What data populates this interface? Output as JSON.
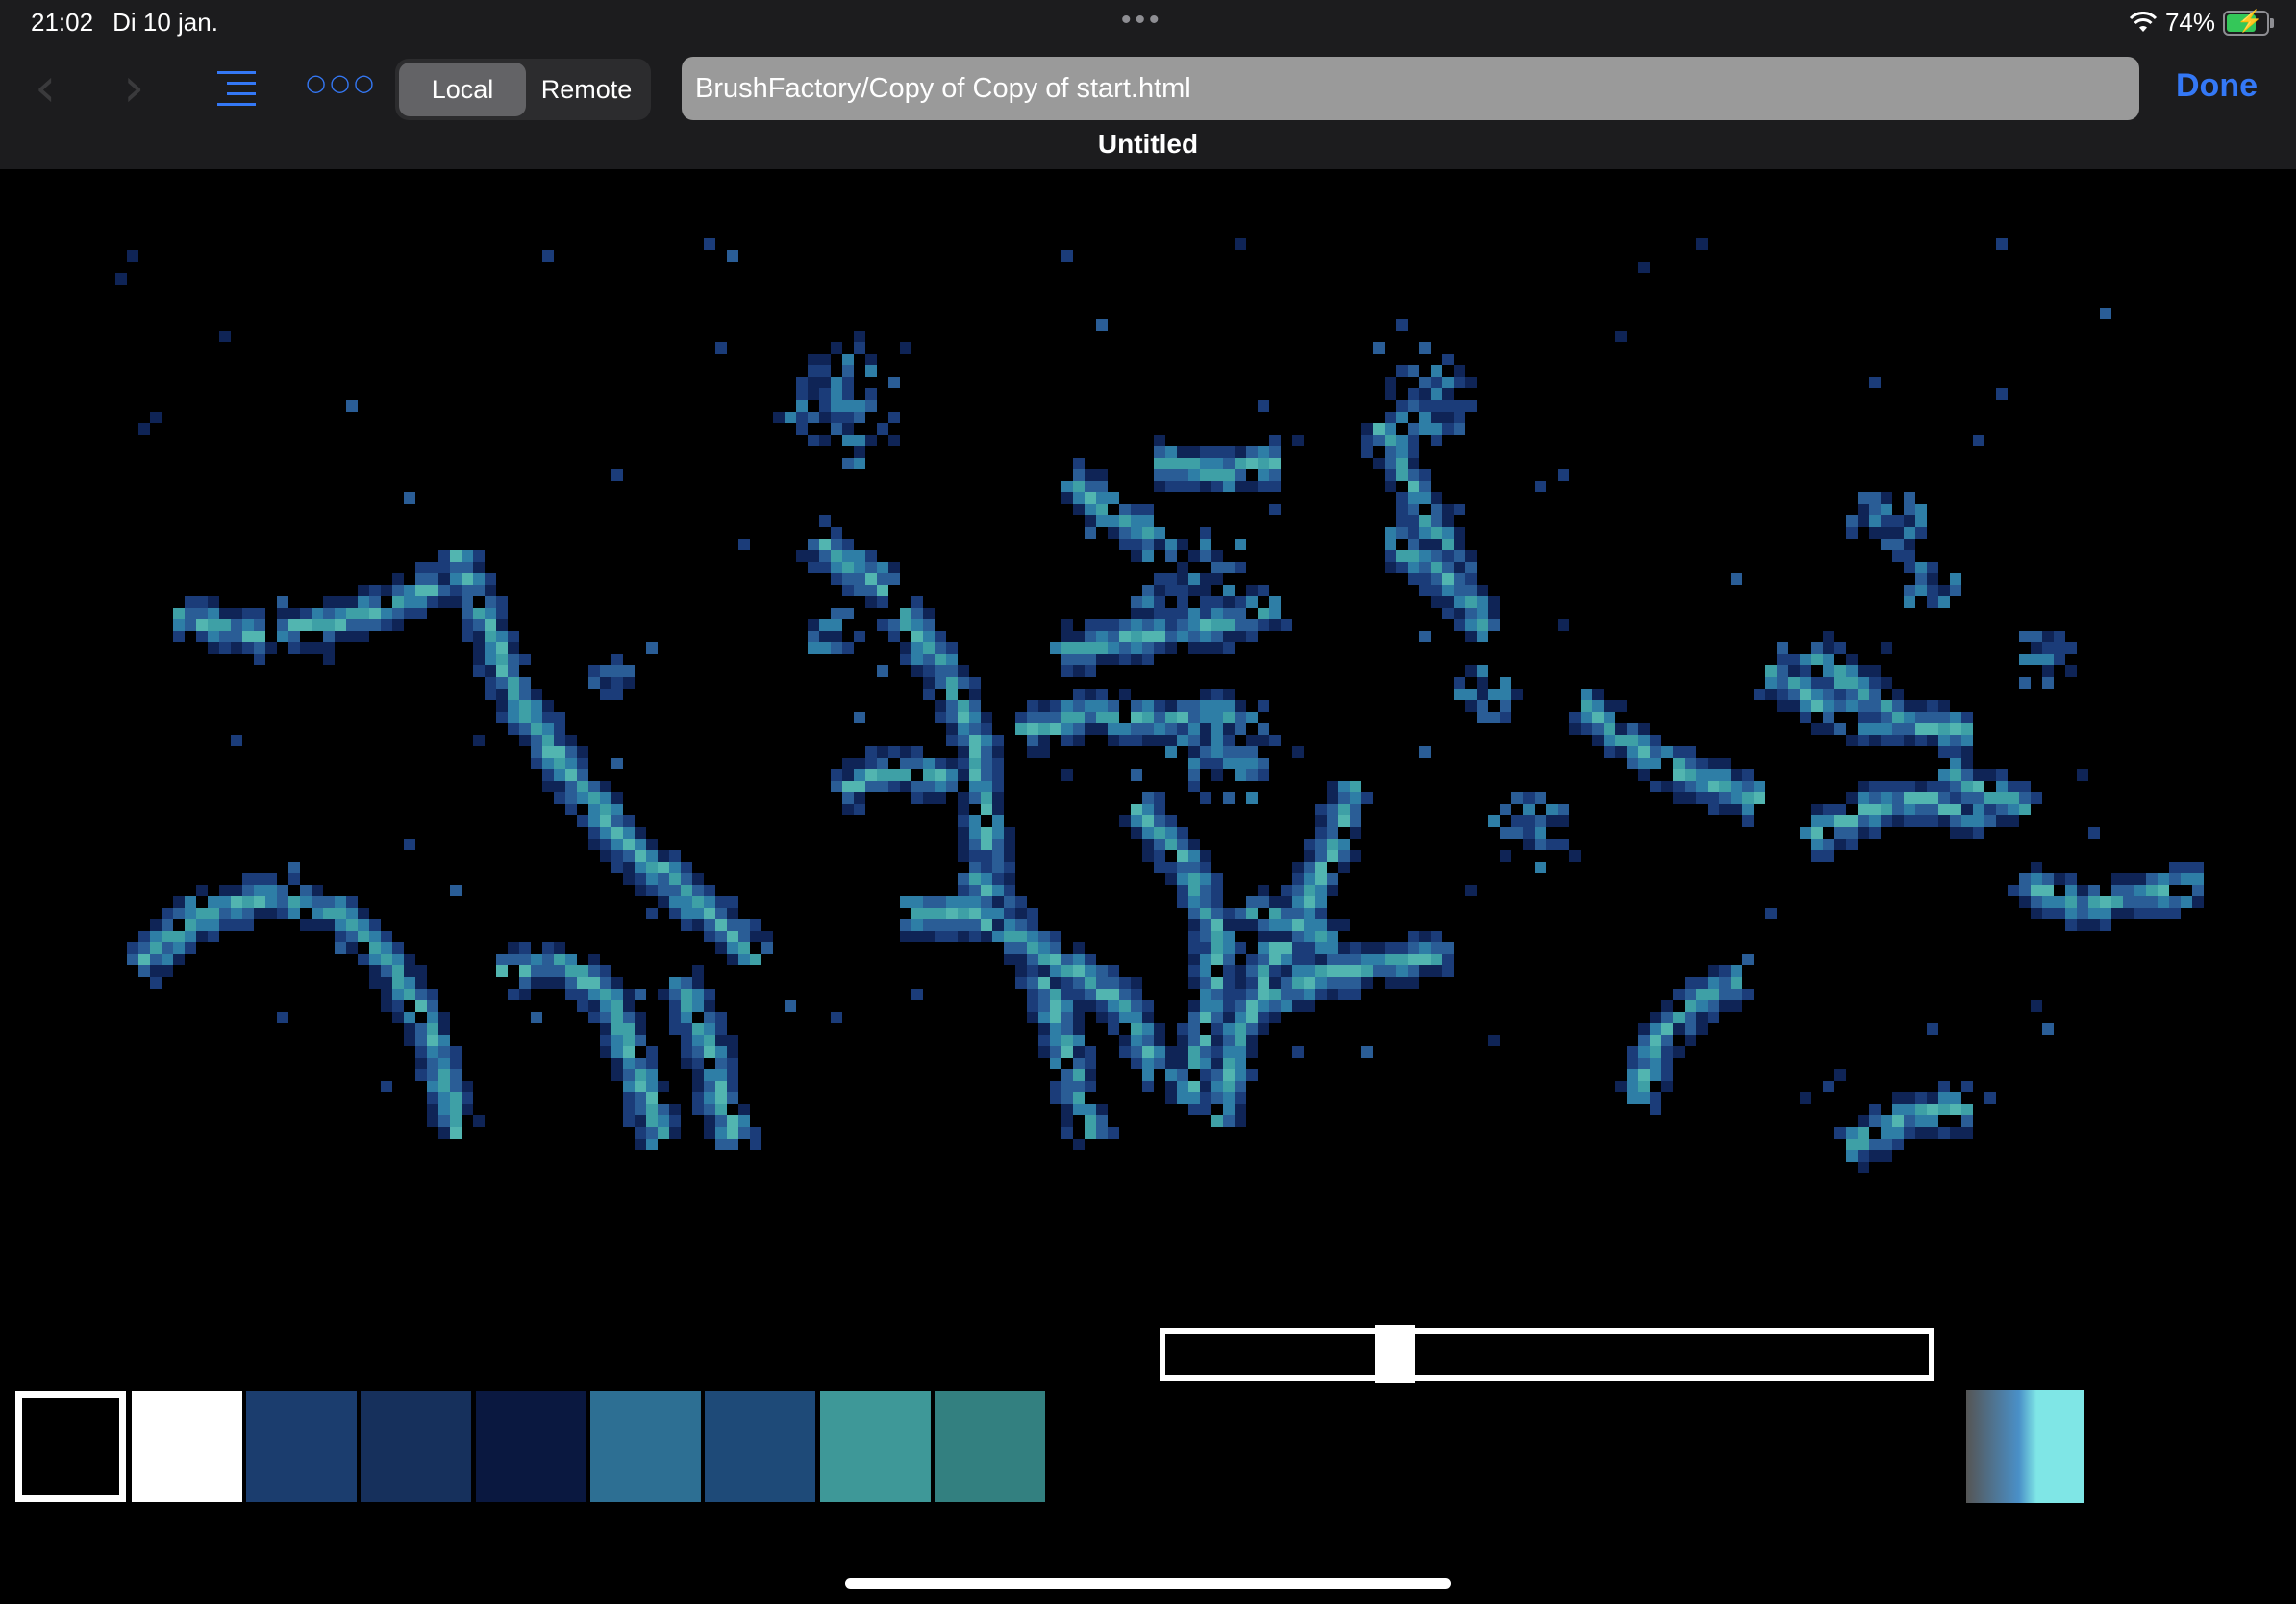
{
  "status_bar": {
    "time": "21:02",
    "date": "Di 10 jan.",
    "multitask_dots": "•••",
    "battery_percent": "74%",
    "battery_level": 0.74,
    "battery_charging": true
  },
  "toolbar": {
    "back_icon": "chevron-left-icon",
    "forward_icon": "chevron-right-icon",
    "toc_icon": "list-indent-icon",
    "more_icon": "ellipsis-icon",
    "segments": [
      {
        "label": "Local",
        "active": true
      },
      {
        "label": "Remote",
        "active": false
      }
    ],
    "path": "BrushFactory/Copy of Copy of start.html",
    "done_label": "Done",
    "document_title": "Untitled"
  },
  "palette": {
    "colors": [
      "#000000",
      "#ffffff",
      "#1b3d6e",
      "#16305c",
      "#0a1840",
      "#2d6f93",
      "#1e4a78",
      "#3e9898",
      "#338080"
    ],
    "selected_index": 0
  },
  "brush_slider": {
    "value": 0.29
  },
  "gradient_swatch": {
    "from": "#555555",
    "to": "#7fe6e6"
  },
  "theme": {
    "accent": "#3478f6",
    "toolbar_bg": "#1c1c1e",
    "canvas_bg": "#000000",
    "stroke_colors": [
      "#0f2456",
      "#1b3c79",
      "#2a5d96",
      "#2e7ea6",
      "#3ea0a6",
      "#52b5b0"
    ]
  }
}
